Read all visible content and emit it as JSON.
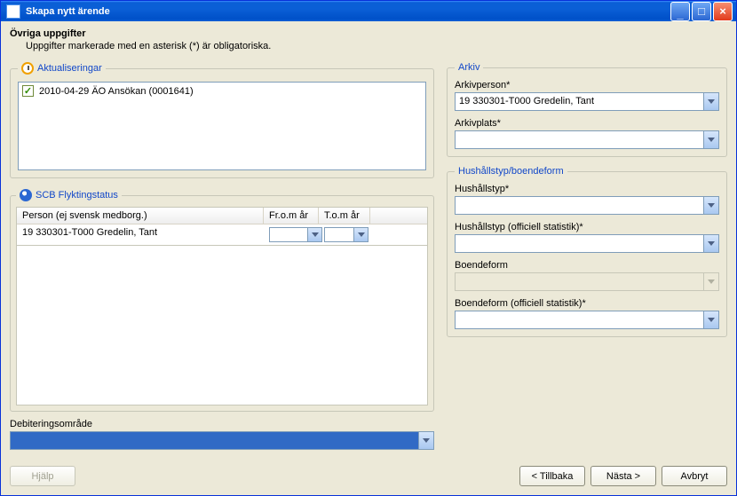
{
  "window": {
    "title": "Skapa nytt ärende"
  },
  "header": {
    "title": "Övriga uppgifter",
    "subtitle": "Uppgifter markerade med en asterisk (*) är obligatoriska."
  },
  "aktual": {
    "legend": "Aktualiseringar",
    "rows": [
      {
        "checked": true,
        "text": "2010-04-29  ÄO Ansökan  (0001641)"
      }
    ]
  },
  "scb": {
    "legend": "SCB Flyktingstatus",
    "columns": {
      "person": "Person (ej svensk medborg.)",
      "from": "Fr.o.m år",
      "to": "T.o.m år"
    },
    "rows": [
      {
        "person": "19 330301-T000 Gredelin, Tant",
        "from": "",
        "to": ""
      }
    ]
  },
  "debit": {
    "label": "Debiteringsområde",
    "value": " "
  },
  "arkiv": {
    "legend": "Arkiv",
    "person_label": "Arkivperson*",
    "person_value": "19 330301-T000   Gredelin, Tant",
    "plats_label": "Arkivplats*",
    "plats_value": ""
  },
  "hush": {
    "legend": "Hushållstyp/boendeform",
    "typ_label": "Hushållstyp*",
    "typ_value": "",
    "typ_off_label": "Hushållstyp (officiell statistik)*",
    "typ_off_value": "",
    "boende_label": "Boendeform",
    "boende_value": "",
    "boende_off_label": "Boendeform (officiell statistik)*",
    "boende_off_value": ""
  },
  "buttons": {
    "help": "Hjälp",
    "back": "< Tillbaka",
    "next": "Nästa >",
    "cancel": "Avbryt"
  }
}
